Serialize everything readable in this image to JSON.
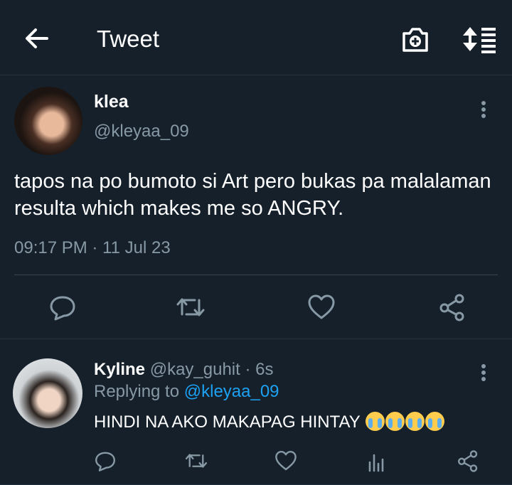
{
  "header": {
    "title": "Tweet",
    "back_icon": "arrow-left-icon",
    "camera_icon": "camera-plus-icon",
    "sort_icon": "sort-list-icon"
  },
  "tweet": {
    "author_name": "klea",
    "author_handle": "@kleyaa_09",
    "text": "tapos na po bumoto si Art pero bukas pa malalaman resulta which makes me so ANGRY.",
    "timestamp": "09:17 PM · 11 Jul 23",
    "actions": [
      "reply-icon",
      "retweet-icon",
      "like-icon",
      "share-icon"
    ]
  },
  "reply": {
    "author_name": "Kyline",
    "author_handle": "@kay_guhit",
    "time": "· 6s",
    "replying_label": "Replying to",
    "replying_handle": "@kleyaa_09",
    "text": "HINDI NA AKO MAKAPAG HINTAY",
    "emoji_count": 4,
    "actions": [
      "reply-icon",
      "retweet-icon",
      "like-icon",
      "analytics-icon",
      "share-icon"
    ]
  },
  "colors": {
    "background": "#15202b",
    "text_secondary": "#8899a6",
    "link": "#1da1f2",
    "divider": "#38444d"
  }
}
